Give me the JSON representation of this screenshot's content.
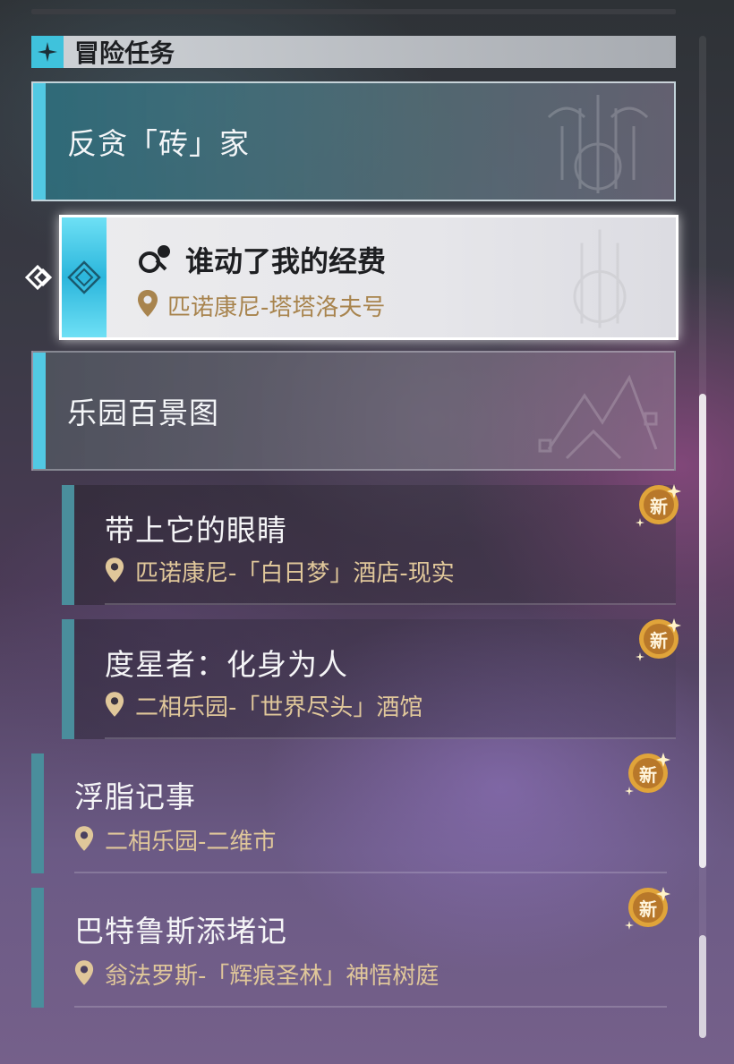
{
  "section": {
    "title": "冒险任务"
  },
  "categories": [
    {
      "label": "反贪「砖」家"
    },
    {
      "label": "乐园百景图"
    }
  ],
  "selected_quest": {
    "title": "谁动了我的经费",
    "location": "匹诺康尼-塔塔洛夫号"
  },
  "quests": [
    {
      "title": "带上它的眼睛",
      "location": "匹诺康尼-「白日梦」酒店-现实",
      "badge": "新"
    },
    {
      "title": "度星者：化身为人",
      "location": "二相乐园-「世界尽头」酒馆",
      "badge": "新"
    },
    {
      "title": "浮脂记事",
      "location": "二相乐园-二维市",
      "badge": "新"
    },
    {
      "title": "巴特鲁斯添堵记",
      "location": "翁法罗斯-「辉痕圣林」神悟树庭",
      "badge": "新"
    }
  ],
  "colors": {
    "accent": "#52c9e3",
    "location_text": "#e0c79a",
    "badge": "#e0a43a"
  }
}
